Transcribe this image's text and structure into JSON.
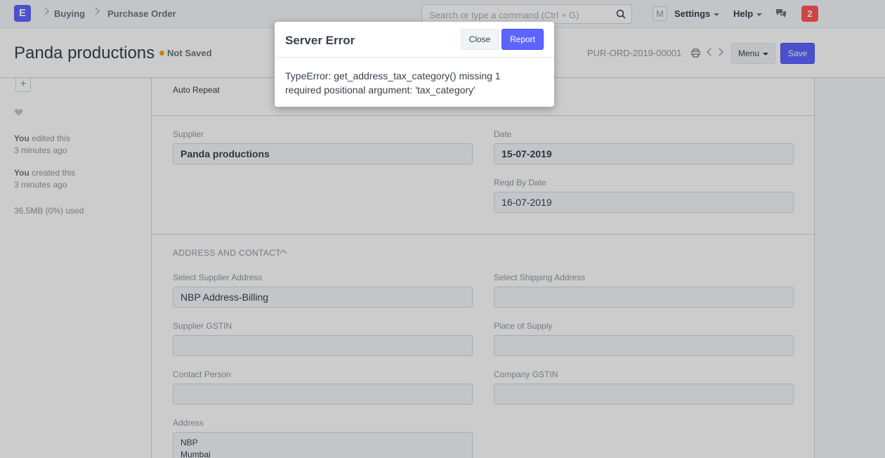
{
  "navbar": {
    "logo": "E",
    "breadcrumbs": [
      "Buying",
      "Purchase Order"
    ],
    "search_placeholder": "Search or type a command (Ctrl + G)",
    "avatar_initial": "M",
    "settings_label": "Settings",
    "help_label": "Help",
    "notification_count": "2"
  },
  "page_head": {
    "title": "Panda productions",
    "status": "Not Saved",
    "doc_name": "PUR-ORD-2019-00001",
    "menu_label": "Menu",
    "save_label": "Save"
  },
  "sidebar": {
    "add_label": "+",
    "activities": [
      {
        "user": "You",
        "action": "edited this",
        "time": "3 minutes ago"
      },
      {
        "user": "You",
        "action": "created this",
        "time": "3 minutes ago"
      }
    ],
    "usage": "36.5MB (0%) used"
  },
  "form": {
    "auto_repeat_label": "Auto Repeat",
    "supplier_label": "Supplier",
    "supplier_value": "Panda productions",
    "date_label": "Date",
    "date_value": "15-07-2019",
    "reqd_by_label": "Reqd By Date",
    "reqd_by_value": "16-07-2019",
    "address_section": "ADDRESS AND CONTACT",
    "supplier_address_label": "Select Supplier Address",
    "supplier_address_value": "NBP Address-Billing",
    "shipping_address_label": "Select Shipping Address",
    "shipping_address_value": "",
    "supplier_gstin_label": "Supplier GSTIN",
    "supplier_gstin_value": "",
    "place_of_supply_label": "Place of Supply",
    "place_of_supply_value": "",
    "contact_person_label": "Contact Person",
    "contact_person_value": "",
    "company_gstin_label": "Company GSTIN",
    "company_gstin_value": "",
    "address_label": "Address",
    "address_lines": [
      "NBP",
      "Mumbai"
    ]
  },
  "modal": {
    "title": "Server Error",
    "close_label": "Close",
    "report_label": "Report",
    "message": "TypeError: get_address_tax_category() missing 1 required positional argument: 'tax_category'"
  },
  "colors": {
    "primary": "#5e64ff",
    "notification": "#ff5858",
    "status_dot": "#ffa00a"
  }
}
